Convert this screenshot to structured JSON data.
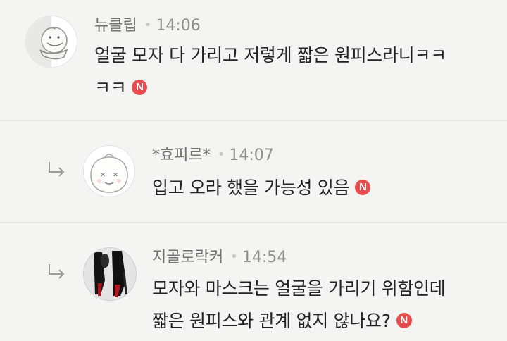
{
  "comments": [
    {
      "author": "뉴클립",
      "time": "14:06",
      "lines": [
        "얼굴 모자 다 가리고 저렇게 짧은 원피스라니ㅋㅋ",
        "ㅋㅋ"
      ],
      "badge": "N",
      "avatar_icon": "hand-holding-face-icon",
      "is_reply": false
    },
    {
      "author": "*효피르*",
      "time": "14:07",
      "lines": [
        "입고 오라 했을 가능성 있음"
      ],
      "badge": "N",
      "avatar_icon": "peach-character-icon",
      "is_reply": true
    },
    {
      "author": "지골로락커",
      "time": "14:54",
      "lines": [
        "모자와 마스크는 얼굴을 가리기 위함인데",
        "짧은 원피스와 관계 없지 않나요?"
      ],
      "badge": "N",
      "avatar_icon": "red-sole-heels-photo",
      "is_reply": true
    }
  ],
  "colors": {
    "background": "#f4f5f3",
    "badge": "#e84c4c",
    "meta_text": "#8c8f8b"
  }
}
